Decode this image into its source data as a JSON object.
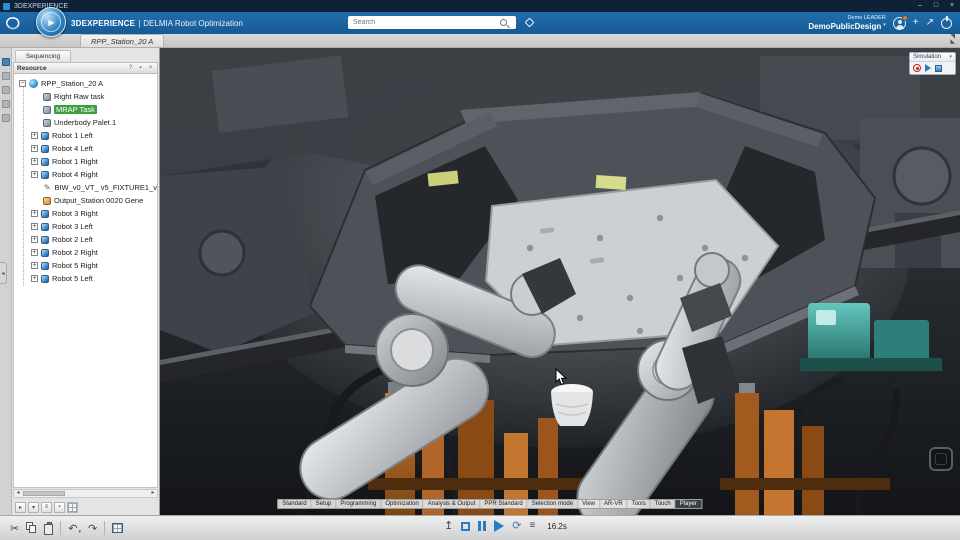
{
  "titlebar": {
    "app": "3DEXPERIENCE"
  },
  "header": {
    "brand_bold": "3DEXPERIENCE",
    "brand_divider": "|",
    "brand_app": "DELMIA Robot Optimization",
    "search_placeholder": "Search",
    "user_line1": "Demo LEADER",
    "user_line2": "DemoPublicDesign"
  },
  "document_tab": {
    "label": "RPP_Station_20 A"
  },
  "left_panel": {
    "sequencing_tab": "Sequencing",
    "resource_panel_title": "Resource",
    "tree": {
      "items": [
        {
          "label": "RPP_Station_20 A"
        },
        {
          "label": "Right Raw task"
        },
        {
          "label": "MRAP Task"
        },
        {
          "label": "Underbody Palet.1"
        },
        {
          "label": "Robot 1 Left"
        },
        {
          "label": "Robot 4 Left"
        },
        {
          "label": "Robot 1 Right"
        },
        {
          "label": "Robot 4 Right"
        },
        {
          "label": "BIW_v0_VT_ v5_FIXTURE1_v"
        },
        {
          "label": "Output_Station 0020 Gene"
        },
        {
          "label": "Robot 3 Right"
        },
        {
          "label": "Robot 3 Left"
        },
        {
          "label": "Robot 2 Left"
        },
        {
          "label": "Robot 2 Right"
        },
        {
          "label": "Robot 5 Right"
        },
        {
          "label": "Robot 5 Left"
        }
      ]
    }
  },
  "viewport": {
    "simulation_panel_title": "Simulation",
    "workbench_tabs": [
      "Standard",
      "Setup",
      "Programming",
      "Optimization",
      "Analysis & Output",
      "PPR Standard",
      "Selection mode",
      "View",
      "AR-VR",
      "Tools",
      "Touch",
      "Player"
    ],
    "active_workbench_tab": "Player"
  },
  "player": {
    "time": "16.2s"
  },
  "icons": {
    "minimize": "–",
    "maximize": "□",
    "close": "×",
    "chevron_down": "▾",
    "share": "↗",
    "plus": "+",
    "minus": "−",
    "help": "?",
    "pin": "▪",
    "panel_close": "×",
    "collapse_left": "◂",
    "scroll_left": "◂",
    "scroll_right": "▸",
    "cut": "✂",
    "undo": "↶",
    "redo": "↷",
    "pencil": "✎",
    "export_up": "↥",
    "loop": "⟳",
    "playlist": "≡",
    "play": "▶",
    "expand_tr": "◥",
    "expand_bl": "◣"
  },
  "colors": {
    "header_blue": "#1b64a4",
    "accent_blue": "#2c7cc4",
    "highlight_green": "#3f9e3f",
    "record_red": "#cc2222",
    "titlebar_navy": "#0d2238"
  }
}
